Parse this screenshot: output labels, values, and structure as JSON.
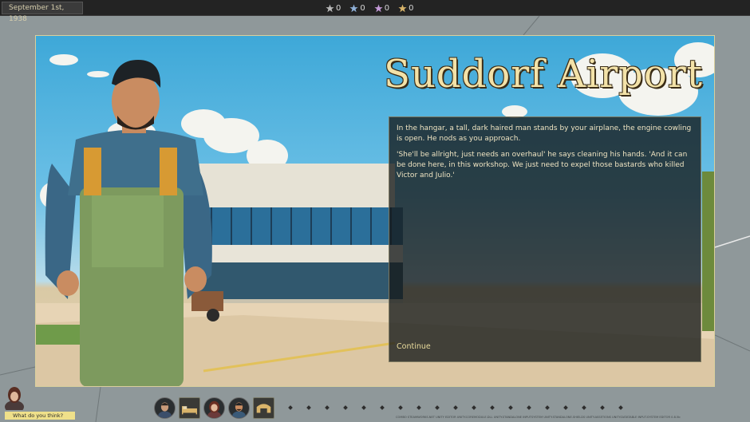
{
  "topbar": {
    "date": "September 1st, 1938",
    "stars": [
      {
        "color": "#b8b8b8",
        "icon": "star-icon",
        "count": "0"
      },
      {
        "color": "#8fb0d8",
        "icon": "star-icon",
        "count": "0"
      },
      {
        "color": "#c49ad8",
        "icon": "star-icon",
        "count": "0"
      },
      {
        "color": "#d8b46a",
        "icon": "star-icon",
        "count": "0"
      }
    ]
  },
  "scene": {
    "location": "Suddorf Airport",
    "dialog": {
      "paragraph1": "In the hangar, a tall, dark haired man stands by your airplane, the engine cowling is open. He nods as you approach.",
      "paragraph2": "'She'll be allright, just needs an overhaul' he says cleaning his hands. 'And it can be done here, in this workshop. We just need to expel those bastards who killed Victor and Julio.'",
      "continue_label": "Continue"
    }
  },
  "bottom": {
    "prompt": "What do you think?",
    "toolbar": [
      {
        "name": "character-portrait-1",
        "icon": "portrait-icon"
      },
      {
        "name": "bed-item",
        "icon": "bed-icon",
        "badge": "0"
      },
      {
        "name": "character-portrait-2",
        "icon": "portrait-icon"
      },
      {
        "name": "character-portrait-3",
        "icon": "portrait-icon",
        "badge": "0"
      },
      {
        "name": "hangar-item",
        "icon": "hangar-icon"
      }
    ],
    "build_info": "COMBO STEAMWORKS.NET UNITY EDITOR UNITY.COREMODULE.DLL UNITY.STANDALONE INPUTSYSTEM UNITY.STANDALONE.SHIELDS UNITY.ASSETIONS UNITY.DATATABLE INPUT.SYSTEM EDITOR 0.8.5b"
  }
}
